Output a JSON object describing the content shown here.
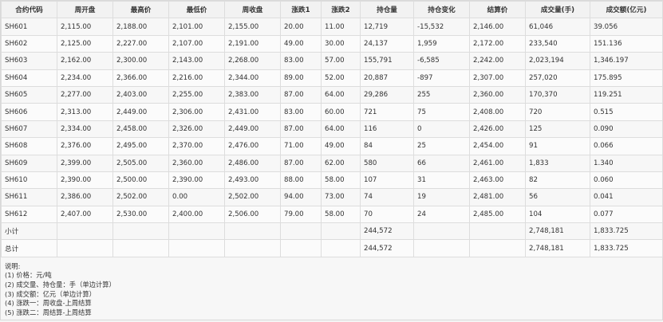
{
  "table": {
    "headers": [
      "合约代码",
      "周开盘",
      "最高价",
      "最低价",
      "周收盘",
      "涨跌1",
      "涨跌2",
      "持仓量",
      "持仓变化",
      "结算价",
      "成交量(手)",
      "成交额(亿元)"
    ],
    "rows": [
      [
        "SH601",
        "2,115.00",
        "2,188.00",
        "2,101.00",
        "2,155.00",
        "20.00",
        "11.00",
        "12,719",
        "-15,532",
        "2,146.00",
        "61,046",
        "39.056"
      ],
      [
        "SH602",
        "2,125.00",
        "2,227.00",
        "2,107.00",
        "2,191.00",
        "49.00",
        "30.00",
        "24,137",
        "1,959",
        "2,172.00",
        "233,540",
        "151.136"
      ],
      [
        "SH603",
        "2,162.00",
        "2,300.00",
        "2,143.00",
        "2,268.00",
        "83.00",
        "57.00",
        "155,791",
        "-6,585",
        "2,242.00",
        "2,023,194",
        "1,346.197"
      ],
      [
        "SH604",
        "2,234.00",
        "2,366.00",
        "2,216.00",
        "2,344.00",
        "89.00",
        "52.00",
        "20,887",
        "-897",
        "2,307.00",
        "257,020",
        "175.895"
      ],
      [
        "SH605",
        "2,277.00",
        "2,403.00",
        "2,255.00",
        "2,383.00",
        "87.00",
        "64.00",
        "29,286",
        "255",
        "2,360.00",
        "170,370",
        "119.251"
      ],
      [
        "SH606",
        "2,313.00",
        "2,449.00",
        "2,306.00",
        "2,431.00",
        "83.00",
        "60.00",
        "721",
        "75",
        "2,408.00",
        "720",
        "0.515"
      ],
      [
        "SH607",
        "2,334.00",
        "2,458.00",
        "2,326.00",
        "2,449.00",
        "87.00",
        "64.00",
        "116",
        "0",
        "2,426.00",
        "125",
        "0.090"
      ],
      [
        "SH608",
        "2,376.00",
        "2,495.00",
        "2,370.00",
        "2,476.00",
        "71.00",
        "49.00",
        "84",
        "25",
        "2,454.00",
        "91",
        "0.066"
      ],
      [
        "SH609",
        "2,399.00",
        "2,505.00",
        "2,360.00",
        "2,486.00",
        "87.00",
        "62.00",
        "580",
        "66",
        "2,461.00",
        "1,833",
        "1.340"
      ],
      [
        "SH610",
        "2,390.00",
        "2,500.00",
        "2,390.00",
        "2,493.00",
        "88.00",
        "58.00",
        "107",
        "31",
        "2,463.00",
        "82",
        "0.060"
      ],
      [
        "SH611",
        "2,386.00",
        "2,502.00",
        "0.00",
        "2,502.00",
        "94.00",
        "73.00",
        "74",
        "19",
        "2,481.00",
        "56",
        "0.041"
      ],
      [
        "SH612",
        "2,407.00",
        "2,530.00",
        "2,400.00",
        "2,506.00",
        "79.00",
        "58.00",
        "70",
        "24",
        "2,485.00",
        "104",
        "0.077"
      ]
    ],
    "summary_rows": [
      [
        "小计",
        "",
        "",
        "",
        "",
        "",
        "",
        "244,572",
        "",
        "",
        "2,748,181",
        "1,833.725"
      ],
      [
        "总计",
        "",
        "",
        "",
        "",
        "",
        "",
        "244,572",
        "",
        "",
        "2,748,181",
        "1,833.725"
      ]
    ]
  },
  "notes": {
    "title": "说明:",
    "lines": [
      "(1) 价格：元/吨",
      "(2) 成交量、持仓量：手（单边计算）",
      "(3) 成交额：亿元（单边计算）",
      "(4) 涨跌一：周收盘-上周结算",
      "(5) 涨跌二：周结算-上周结算"
    ]
  }
}
